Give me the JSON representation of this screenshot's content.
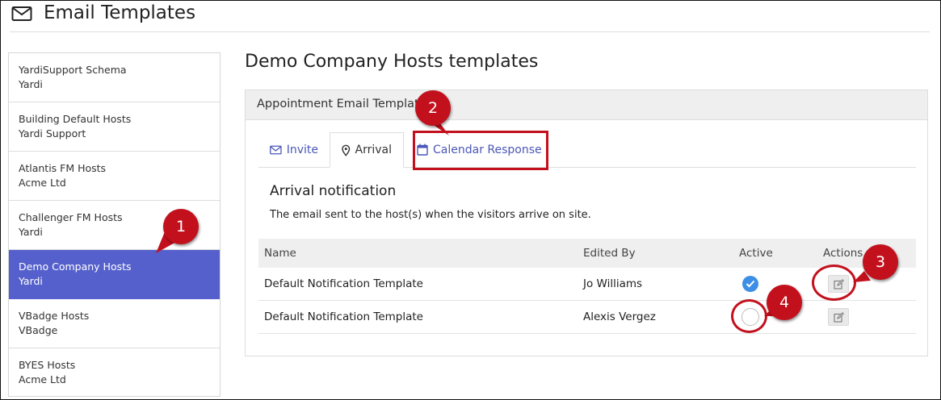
{
  "page": {
    "title": "Email Templates",
    "icon": "envelope-icon"
  },
  "sidebar": {
    "items": [
      {
        "name": "YardiSupport Schema",
        "org": "Yardi",
        "active": false
      },
      {
        "name": "Building Default Hosts",
        "org": "Yardi Support",
        "active": false
      },
      {
        "name": "Atlantis FM Hosts",
        "org": "Acme Ltd",
        "active": false
      },
      {
        "name": "Challenger FM Hosts",
        "org": "Yardi",
        "active": false
      },
      {
        "name": "Demo Company Hosts",
        "org": "Yardi",
        "active": true
      },
      {
        "name": "VBadge Hosts",
        "org": "VBadge",
        "active": false
      },
      {
        "name": "BYES Hosts",
        "org": "Acme Ltd",
        "active": false
      }
    ]
  },
  "main": {
    "title": "Demo Company Hosts templates",
    "panel_heading": "Appointment Email Templates",
    "tabs": [
      {
        "label": "Invite",
        "icon": "envelope-icon",
        "active": false
      },
      {
        "label": "Arrival",
        "icon": "map-pin-icon",
        "active": true
      },
      {
        "label": "Calendar Response",
        "icon": "calendar-icon",
        "active": false
      }
    ],
    "section_title": "Arrival notification",
    "section_description": "The email sent to the host(s) when the visitors arrive on site.",
    "table": {
      "headers": {
        "name": "Name",
        "edited_by": "Edited By",
        "active": "Active",
        "actions": "Actions"
      },
      "rows": [
        {
          "name": "Default Notification Template",
          "edited_by": "Jo Williams",
          "active": true
        },
        {
          "name": "Default Notification Template",
          "edited_by": "Alexis Vergez",
          "active": false
        }
      ]
    }
  },
  "annotations": {
    "callouts": [
      "1",
      "2",
      "3",
      "4"
    ],
    "color": "#c2111d"
  },
  "colors": {
    "sidebar_active": "#5560cc",
    "link": "#4a56b8",
    "check": "#3d8fe6"
  }
}
